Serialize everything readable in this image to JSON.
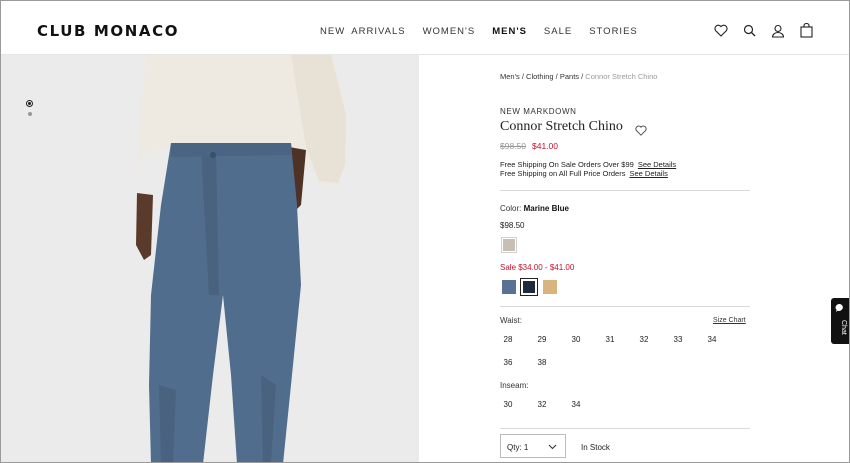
{
  "header": {
    "logo": "CLUB MONACO",
    "nav": [
      "NEW  ARRIVALS",
      "WOMEN'S",
      "MEN'S",
      "SALE",
      "STORIES"
    ],
    "active_nav": "MEN'S",
    "icons": [
      "heart-icon",
      "search-icon",
      "account-icon",
      "bag-icon"
    ]
  },
  "gallery": {
    "dots": 2,
    "active_dot": 1
  },
  "breadcrumb": {
    "items": [
      "Men's",
      "Clothing",
      "Pants"
    ],
    "current": "Connor Stretch Chino",
    "separator": " / "
  },
  "product": {
    "badge": "NEW MARKDOWN",
    "title": "Connor Stretch Chino",
    "original_price": "$98.50",
    "sale_price": "$41.00",
    "shipping_1": "Free Shipping On Sale Orders Over $99",
    "shipping_1_link": "See Details",
    "shipping_2": "Free Shipping on All Full Price Orders",
    "shipping_2_link": "See Details"
  },
  "color": {
    "label": "Color:",
    "selected": "Marine Blue",
    "full_price": "$98.50",
    "sale_range": "Sale $34.00 - $41.00",
    "full_price_swatches": [
      "#c7bfb1"
    ],
    "sale_swatches": [
      "#5a7196",
      "#1f2a3d",
      "#d8b47e"
    ]
  },
  "waist": {
    "label": "Waist:",
    "size_chart": "Size Chart",
    "sizes": [
      "28",
      "29",
      "30",
      "31",
      "32",
      "33",
      "34",
      "36",
      "38"
    ]
  },
  "inseam": {
    "label": "Inseam:",
    "sizes": [
      "30",
      "32",
      "34"
    ]
  },
  "purchase": {
    "qty_label": "Qty: 1",
    "stock": "In Stock"
  },
  "chat": {
    "label": "Chat"
  },
  "colors": {
    "sale_red": "#c8102e",
    "pants_blue": "#516d8e",
    "sweater": "#efeae1"
  }
}
